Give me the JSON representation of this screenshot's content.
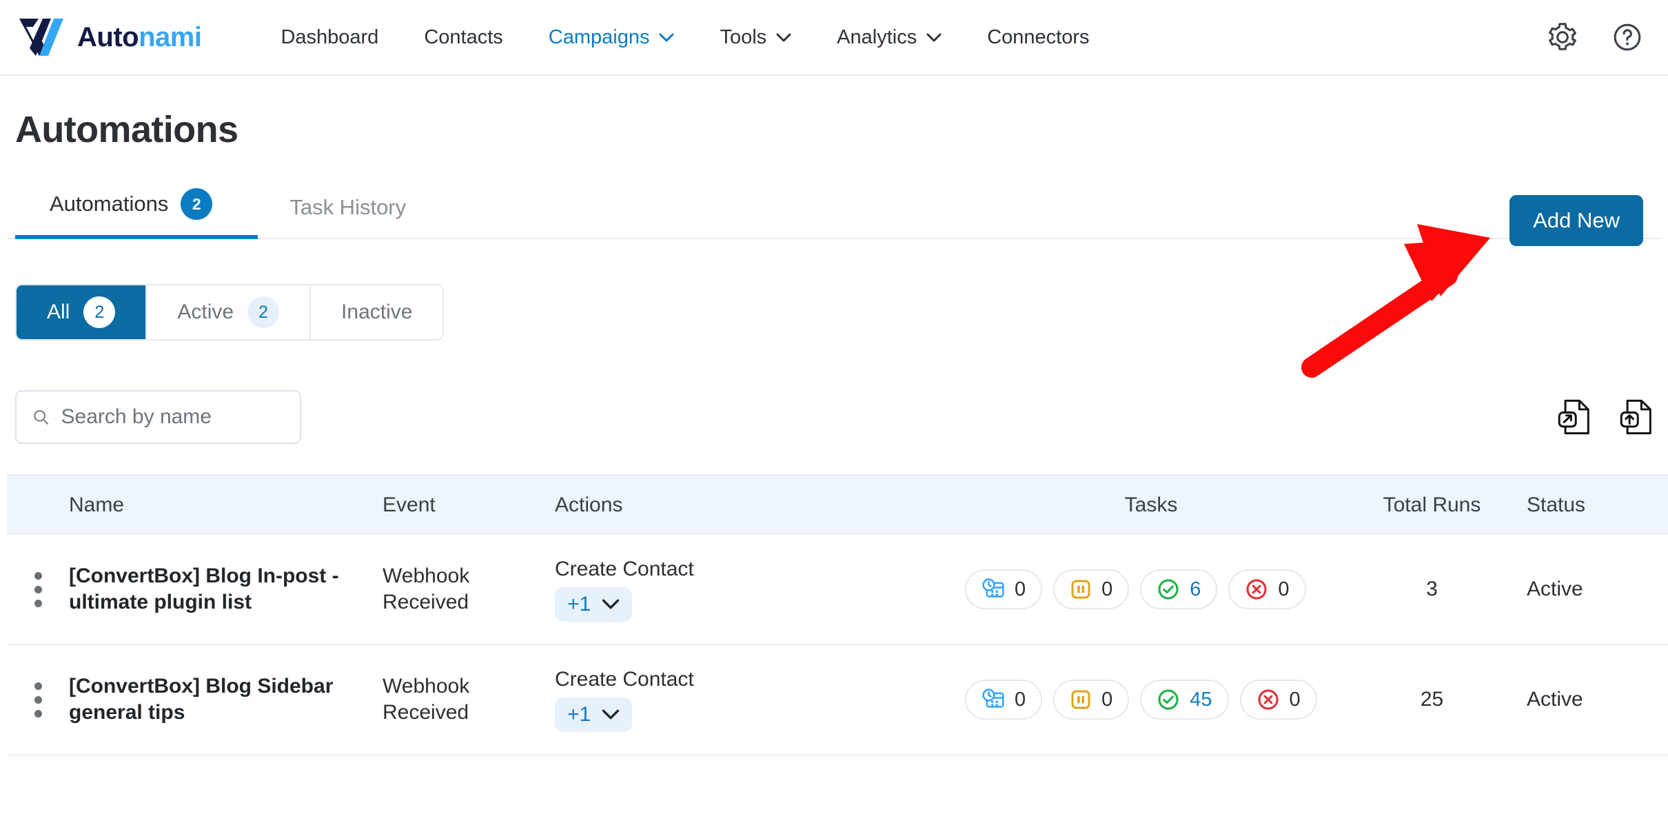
{
  "brand": {
    "name_part1": "Auto",
    "name_part2": "nami",
    "logo_icon": "autonami-v-logo"
  },
  "topnav": {
    "items": [
      {
        "label": "Dashboard",
        "has_chevron": false,
        "active": false
      },
      {
        "label": "Contacts",
        "has_chevron": false,
        "active": false
      },
      {
        "label": "Campaigns",
        "has_chevron": true,
        "active": true
      },
      {
        "label": "Tools",
        "has_chevron": true,
        "active": false
      },
      {
        "label": "Analytics",
        "has_chevron": true,
        "active": false
      },
      {
        "label": "Connectors",
        "has_chevron": false,
        "active": false
      }
    ],
    "settings_icon": "gear-icon",
    "help_icon": "help-circle-icon"
  },
  "page": {
    "title": "Automations"
  },
  "tabs": [
    {
      "label": "Automations",
      "badge": "2",
      "active": true
    },
    {
      "label": "Task History",
      "badge": "",
      "active": false
    }
  ],
  "add_new_button": {
    "label": "Add New"
  },
  "filters": [
    {
      "label": "All",
      "count": "2",
      "active": true
    },
    {
      "label": "Active",
      "count": "2",
      "active": false
    },
    {
      "label": "Inactive",
      "count": "",
      "active": false
    }
  ],
  "search": {
    "placeholder": "Search by name",
    "value": "",
    "icon": "search-icon"
  },
  "toolbar_icons": [
    {
      "name": "export-file-icon"
    },
    {
      "name": "import-file-icon"
    }
  ],
  "table": {
    "columns": [
      "Name",
      "Event",
      "Actions",
      "Tasks",
      "Total Runs",
      "Status"
    ],
    "rows": [
      {
        "name": "[ConvertBox] Blog In-post - ultimate plugin list",
        "event": "Webhook Received",
        "action": "Create Contact",
        "action_more": "+1",
        "tasks": {
          "scheduled": "0",
          "paused": "0",
          "completed": "6",
          "failed": "0"
        },
        "total_runs": "3",
        "status": "Active"
      },
      {
        "name": "[ConvertBox] Blog Sidebar general tips",
        "event": "Webhook Received",
        "action": "Create Contact",
        "action_more": "+1",
        "tasks": {
          "scheduled": "0",
          "paused": "0",
          "completed": "45",
          "failed": "0"
        },
        "total_runs": "25",
        "status": "Active"
      }
    ]
  },
  "annotation": {
    "type": "red-arrow",
    "points_to": "Add New"
  },
  "colors": {
    "accent_blue": "#0b6ba3",
    "link_blue": "#1379bd",
    "brand_light_blue": "#35a6f5",
    "brand_navy": "#111b44",
    "header_bg": "#eef5fd",
    "annotation_red": "#fa0a08",
    "task_scheduled": "#35a6f5",
    "task_paused": "#e0a319",
    "task_completed": "#22b24c",
    "task_failed": "#e2323a"
  }
}
